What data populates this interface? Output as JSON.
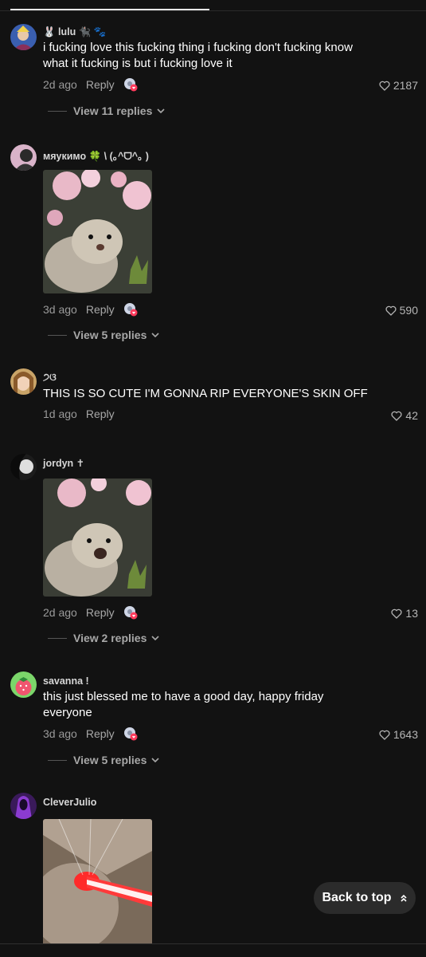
{
  "comments": [
    {
      "username": "🐰 lulu 🐈‍⬛ 🐾",
      "text": "i fucking love this fucking thing i fucking don't fucking know what it fucking is but i fucking love it",
      "age": "2d ago",
      "reply_label": "Reply",
      "likes": "2187",
      "replies_label": "View 11 replies"
    },
    {
      "username": "мяукимо 🍀 \\ (｡^ᗜ^｡ )",
      "text": "",
      "age": "3d ago",
      "reply_label": "Reply",
      "likes": "590",
      "replies_label": "View 5 replies"
    },
    {
      "username": "੭ଓ",
      "text": "THIS IS SO CUTE I'M GONNA RIP EVERYONE'S SKIN OFF",
      "age": "1d ago",
      "reply_label": "Reply",
      "likes": "42",
      "replies_label": ""
    },
    {
      "username": "jordyn ✝",
      "text": "",
      "age": "2d ago",
      "reply_label": "Reply",
      "likes": "13",
      "replies_label": "View 2 replies"
    },
    {
      "username": "savanna !",
      "text": "this just blessed me to have a good day, happy friday everyone",
      "age": "3d ago",
      "reply_label": "Reply",
      "likes": "1643",
      "replies_label": "View 5 replies"
    },
    {
      "username": "CleverJulio",
      "text": "",
      "age": "",
      "reply_label": "",
      "likes": "",
      "replies_label": ""
    }
  ],
  "back_to_top": {
    "label": "Back to top",
    "icon": "double-chevron-up-icon"
  },
  "colors": {
    "background": "#121212",
    "muted_text": "#9a9a9a",
    "accent_pink": "#ff3b5c"
  }
}
